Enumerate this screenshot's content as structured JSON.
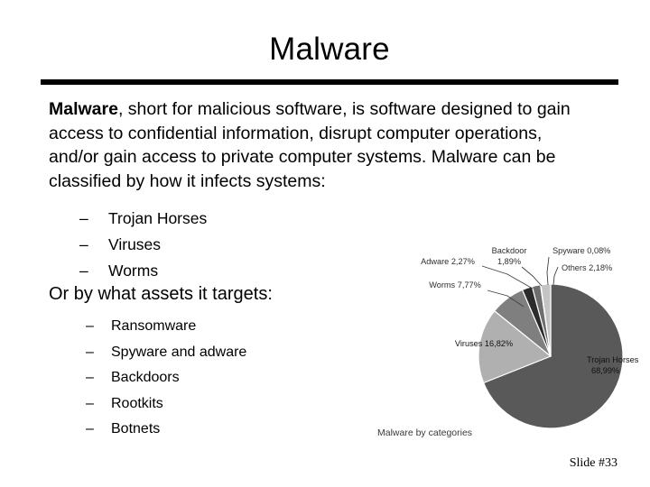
{
  "slide": {
    "title": "Malware",
    "body": {
      "lead": "Malware",
      "rest": ", short for malicious software, is software designed to gain access to confidential information, disrupt computer operations, and/or gain access to private computer systems. Malware can be classified by how it infects systems:"
    },
    "infection_list": [
      {
        "dash": "–",
        "label": "Trojan Horses"
      },
      {
        "dash": "–",
        "label": "Viruses"
      },
      {
        "dash": "–",
        "label": "Worms"
      }
    ],
    "assets_lead": "Or by what assets it targets:",
    "assets_list": [
      {
        "dash": "–",
        "label": "Ransomware"
      },
      {
        "dash": "–",
        "label": "Spyware and adware"
      },
      {
        "dash": "–",
        "label": "Backdoors"
      },
      {
        "dash": "–",
        "label": "Rootkits"
      },
      {
        "dash": "–",
        "label": "Botnets"
      }
    ],
    "slide_number": "Slide #33"
  },
  "chart_data": {
    "type": "pie",
    "title": "",
    "caption": "Malware by categories",
    "legend": "none",
    "value_format": "comma-decimal-percent",
    "categories": [
      "Trojan Horses",
      "Viruses",
      "Worms",
      "Adware",
      "Backdoor",
      "Spyware",
      "Others"
    ],
    "values": [
      68.99,
      16.82,
      7.77,
      2.27,
      1.89,
      0.08,
      2.18
    ],
    "labels": [
      "Trojan Horses 68,99%",
      "Viruses 16,82%",
      "Worms 7,77%",
      "Adware 2,27%",
      "Backdoor 1,89%",
      "Spyware 0,08%",
      "Others 2,18%"
    ],
    "label_lines": {
      "trojan_horses": [
        "Trojan Horses",
        "68,99%"
      ],
      "viruses": "Viruses 16,82%",
      "worms": "Worms 7,77%",
      "adware": "Adware 2,27%",
      "backdoor_top": "Backdoor",
      "backdoor_pct": "1,89%",
      "spyware": "Spyware 0,08%",
      "others": "Others 2,18%"
    },
    "colors": {
      "trojan_horses": "#595959",
      "viruses": "#b0b0b0",
      "worms": "#7f7f7f",
      "adware": "#2b2b2b",
      "backdoor": "#6e6e6e",
      "spyware": "#d9d9d9",
      "others": "#c4c4c4",
      "label_text": "#2f2f2f",
      "leader_line": "#404040",
      "slice_border": "#ffffff"
    }
  }
}
